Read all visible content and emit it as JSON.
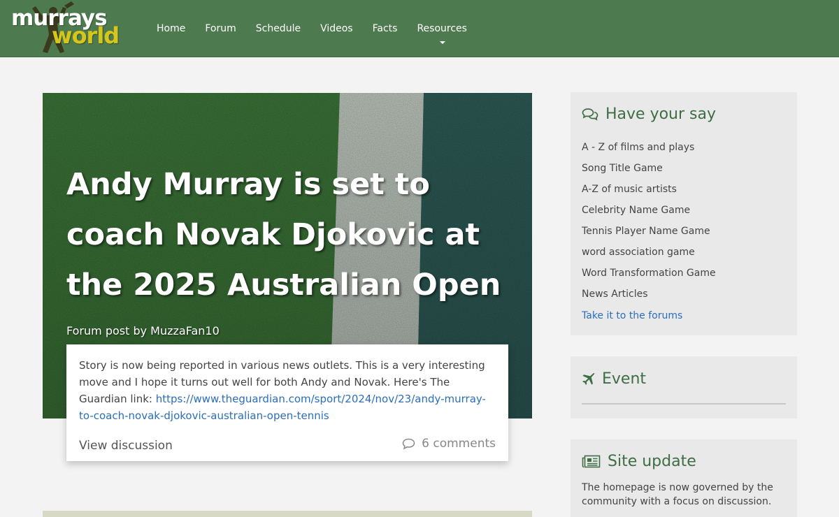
{
  "header": {
    "logo_line1": "murrays",
    "logo_line2": "world",
    "nav": [
      {
        "label": "Home"
      },
      {
        "label": "Forum"
      },
      {
        "label": "Schedule"
      },
      {
        "label": "Videos"
      },
      {
        "label": "Facts"
      },
      {
        "label": "Resources",
        "has_dropdown": true
      }
    ],
    "colors": {
      "bar": "#4d7a4e",
      "logo_accent": "#d6c51b"
    }
  },
  "feature": {
    "title": "Andy Murray is set to coach Novak Djokovic at the 2025 Australian Open",
    "byline": "Forum post by MuzzaFan10",
    "body_text": "Story is now being reported in various news outlets. This is a very interesting move and I hope it turns out well for both Andy and Novak. Here's The Guardian link: ",
    "body_link": "https://www.theguardian.com/sport/2024/nov/23/andy-murray-to-coach-novak-djokovic-australian-open-tennis",
    "view_label": "View discussion",
    "comments_label": "6 comments"
  },
  "sidebar": {
    "have_your_say": {
      "title": "Have your say",
      "icon": "comments-icon",
      "items": [
        {
          "label": "A - Z of films and plays"
        },
        {
          "label": "Song Title Game"
        },
        {
          "label": "A-Z of music artists"
        },
        {
          "label": "Celebrity Name Game"
        },
        {
          "label": "Tennis Player Name Game"
        },
        {
          "label": "word association game"
        },
        {
          "label": "Word Transformation Game"
        },
        {
          "label": "News Articles"
        }
      ],
      "link": "Take it to the forums"
    },
    "event": {
      "title": "Event",
      "icon": "plane-icon"
    },
    "site_update": {
      "title": "Site update",
      "icon": "newspaper-icon",
      "text": "The homepage is now governed by the community with a focus on discussion."
    }
  }
}
